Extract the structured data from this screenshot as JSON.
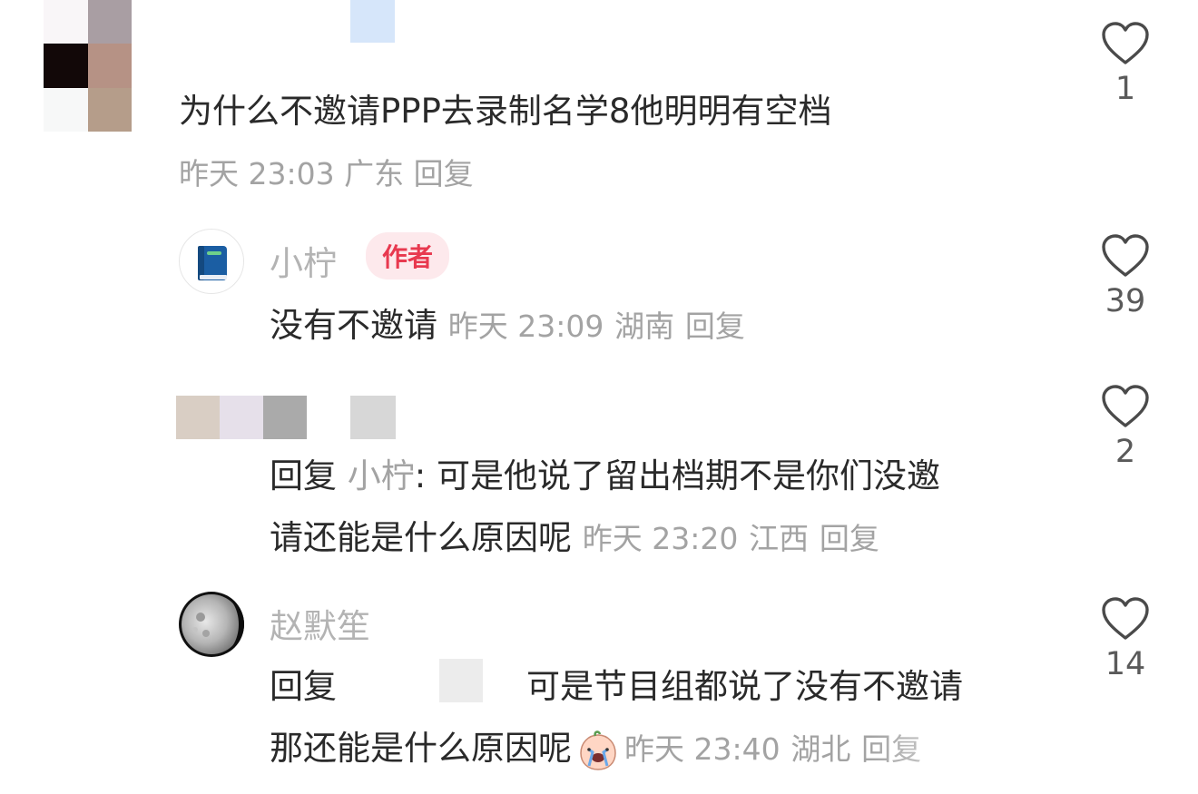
{
  "accent_color": "#e8394f",
  "comments": [
    {
      "text": "为什么不邀请PPP去录制名学8他明明有空档",
      "time": "昨天 23:03",
      "location": "广东",
      "reply_label": "回复",
      "likes": "1",
      "avatar": "pixelated-avatar"
    },
    {
      "username": "小柠",
      "badge": "作者",
      "text": "没有不邀请",
      "time": "昨天 23:09",
      "location": "湖南",
      "reply_label": "回复",
      "likes": "39",
      "avatar": "book-icon"
    },
    {
      "reply_prefix": "回复",
      "reply_to": "小柠",
      "text_line1": ": 可是他说了留出档期不是你们没邀",
      "text_line2": "请还能是什么原因呢",
      "time": "昨天 23:20",
      "location": "江西",
      "reply_label": "回复",
      "likes": "2",
      "avatar": "pixelated-username"
    },
    {
      "username": "赵默笙",
      "reply_prefix": "回复",
      "text_line1": "可是节目组都说了没有不邀请",
      "text_line2": "那还能是什么原因呢",
      "emoji": "crying-peach-emoji",
      "time": "昨天 23:40",
      "location": "湖北",
      "reply_label": "回复",
      "likes": "14",
      "avatar": "moon-avatar"
    }
  ]
}
